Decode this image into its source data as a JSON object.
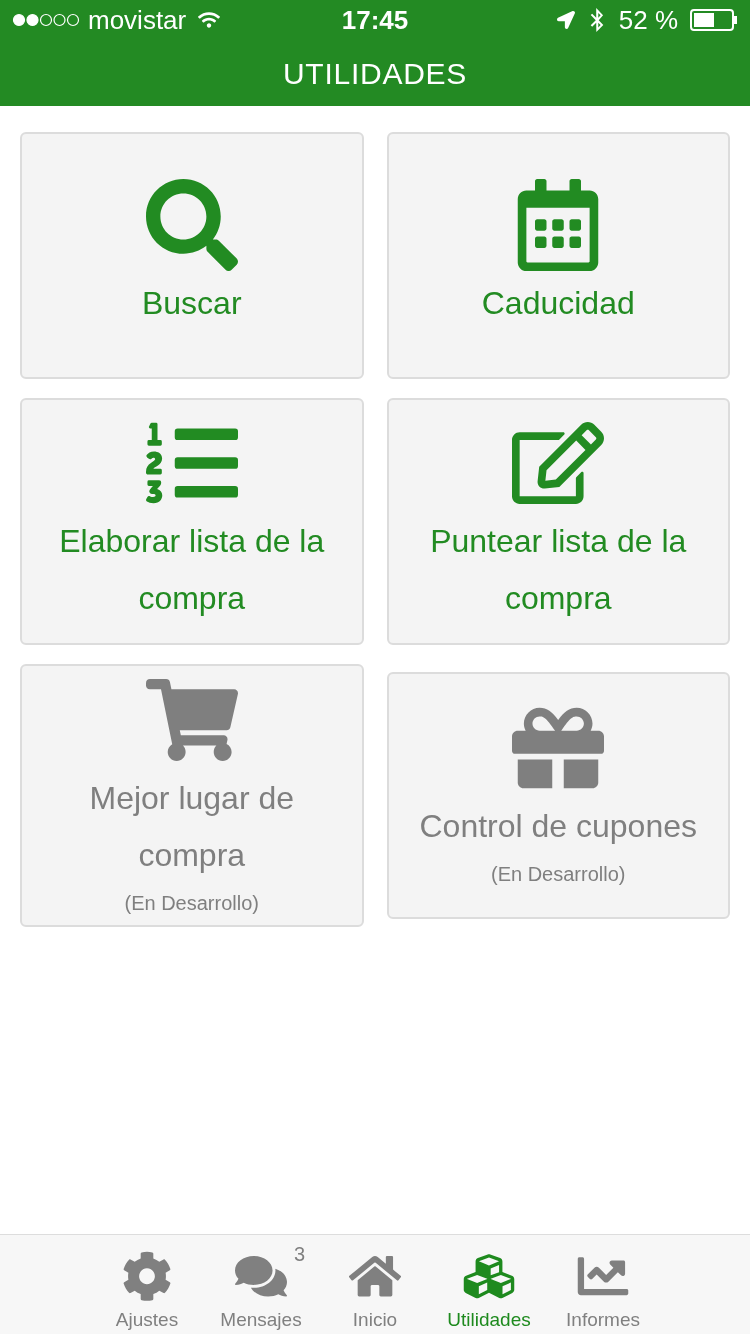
{
  "status_bar": {
    "carrier": "movistar",
    "time": "17:45",
    "battery": "52 %"
  },
  "header": {
    "title": "UTILIDADES"
  },
  "tiles": [
    {
      "title": "Buscar",
      "disabled": false
    },
    {
      "title": "Caducidad",
      "disabled": false
    },
    {
      "title": "Elaborar lista de la compra",
      "disabled": false
    },
    {
      "title": "Puntear lista de la compra",
      "disabled": false
    },
    {
      "title": "Mejor lugar de compra",
      "note": "(En Desarrollo)",
      "disabled": true
    },
    {
      "title": "Control de cupones",
      "note": "(En Desarrollo)",
      "disabled": true
    }
  ],
  "tab_bar": [
    {
      "label": "Ajustes",
      "selected": false
    },
    {
      "label": "Mensajes",
      "badge": "3",
      "selected": false
    },
    {
      "label": "Inicio",
      "selected": false
    },
    {
      "label": "Utilidades",
      "selected": true
    },
    {
      "label": "Informes",
      "selected": false
    }
  ]
}
